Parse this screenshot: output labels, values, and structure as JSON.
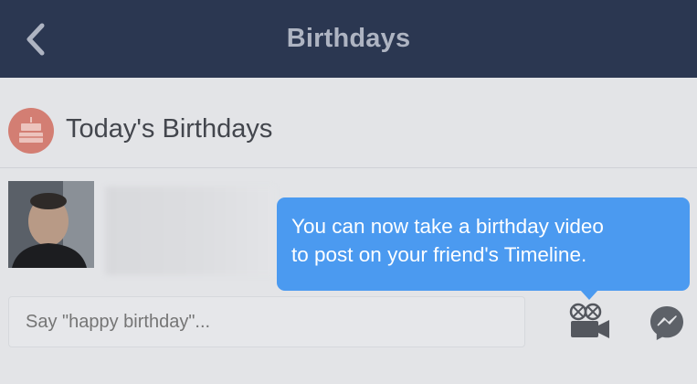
{
  "nav": {
    "title": "Birthdays",
    "back_icon": "chevron-left-icon"
  },
  "section": {
    "title": "Today's Birthdays",
    "icon": "birthday-cake-icon",
    "icon_color": "#d37e73"
  },
  "friend": {
    "avatar_icon": "profile-photo"
  },
  "composer": {
    "placeholder": "Say \"happy birthday\"..."
  },
  "actions": {
    "video_icon": "video-camera-icon",
    "messenger_icon": "messenger-icon"
  },
  "tooltip": {
    "text": "You can now take a birthday video\nto post on your friend's Timeline.",
    "color": "#4b9af0"
  },
  "colors": {
    "navbar": "#2b3751",
    "background": "#e3e4e7"
  }
}
